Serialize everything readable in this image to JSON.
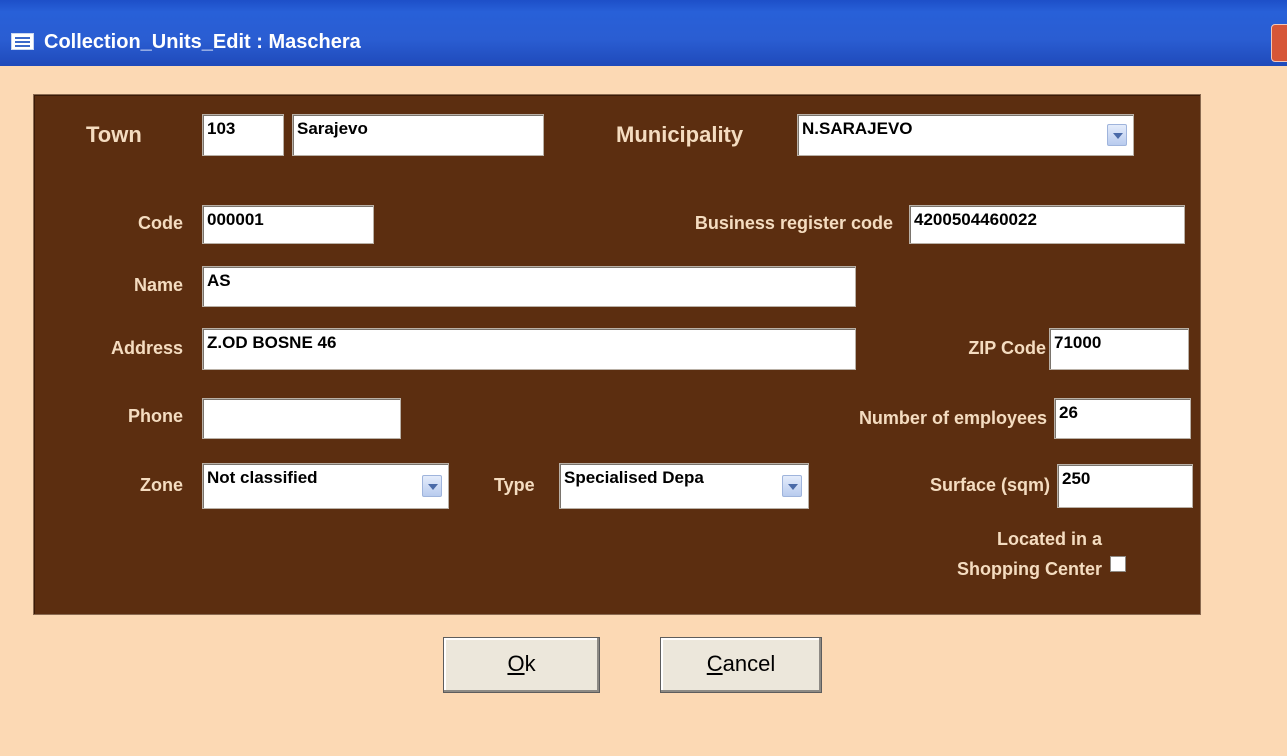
{
  "window": {
    "title": "Collection_Units_Edit : Maschera"
  },
  "form": {
    "town": {
      "label": "Town",
      "code": "103",
      "name": "Sarajevo"
    },
    "municipality": {
      "label": "Municipality",
      "value": "N.SARAJEVO"
    },
    "code": {
      "label": "Code",
      "value": "000001"
    },
    "business_register_code": {
      "label": "Business register code",
      "value": "4200504460022"
    },
    "name": {
      "label": "Name",
      "value": "AS"
    },
    "address": {
      "label": "Address",
      "value": "Z.OD BOSNE 46"
    },
    "zip_code": {
      "label": "ZIP Code",
      "value": "71000"
    },
    "phone": {
      "label": "Phone",
      "value": ""
    },
    "number_of_employees": {
      "label": "Number of employees",
      "value": "26"
    },
    "zone": {
      "label": "Zone",
      "value": "Not classified"
    },
    "type": {
      "label": "Type",
      "value": "Specialised Depa"
    },
    "surface": {
      "label": "Surface (sqm)",
      "value": "250"
    },
    "shopping_center": {
      "label_line1": "Located in a",
      "label_line2": "Shopping Center",
      "checked": false
    }
  },
  "buttons": {
    "ok": {
      "accel": "O",
      "rest": "k"
    },
    "cancel": {
      "accel": "C",
      "rest": "ancel"
    }
  },
  "icons": {
    "form": "form-icon",
    "close": "close-icon",
    "dropdown": "chevron-down-icon"
  },
  "colors": {
    "titlebar": "#2a5dd2",
    "background": "#fcd9b4",
    "panel": "#5c2e10",
    "label": "#f4dcc0"
  }
}
